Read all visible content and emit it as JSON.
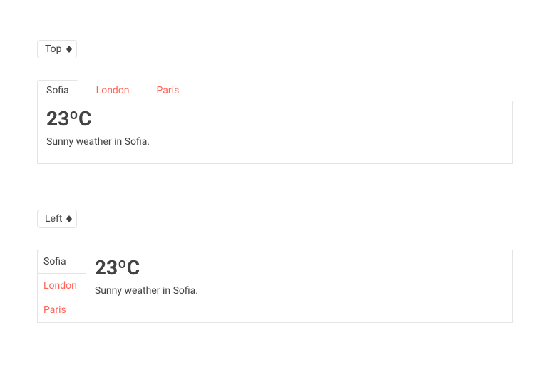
{
  "section1": {
    "position_select": {
      "value": "Top"
    },
    "tabs": [
      {
        "label": "Sofia",
        "active": true
      },
      {
        "label": "London",
        "active": false
      },
      {
        "label": "Paris",
        "active": false
      }
    ],
    "content": {
      "temperature": "23ºC",
      "description": "Sunny weather in Sofia."
    }
  },
  "section2": {
    "position_select": {
      "value": "Left"
    },
    "tabs": [
      {
        "label": "Sofia",
        "active": true
      },
      {
        "label": "London",
        "active": false
      },
      {
        "label": "Paris",
        "active": false
      }
    ],
    "content": {
      "temperature": "23ºC",
      "description": "Sunny weather in Sofia."
    }
  }
}
